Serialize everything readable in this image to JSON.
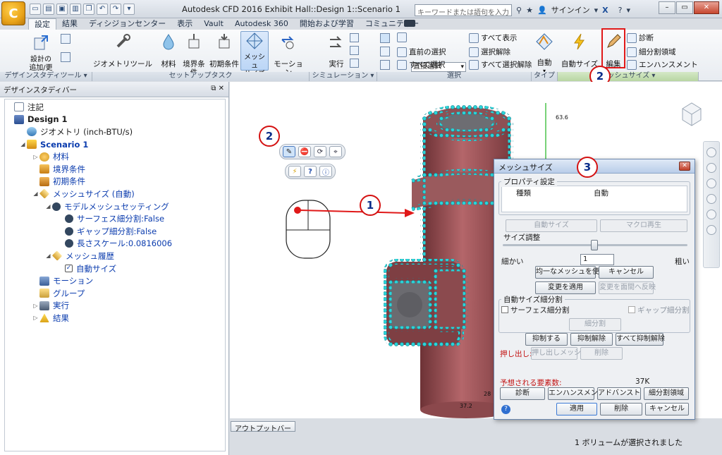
{
  "app": {
    "title": "Autodesk CFD 2016   Exhibit Hall::Design 1::Scenario 1",
    "search_placeholder": "キーワードまたは語句を入力",
    "signin": "サインイン"
  },
  "tabs": [
    "設定",
    "結果",
    "ディシジョンセンター",
    "表示",
    "Vault",
    "Autodesk 360",
    "開始および学習",
    "コミュニティー"
  ],
  "ribbon": {
    "design_study": {
      "add_update": "設計の\n追加/更新",
      "footer": "デザインスタディツール ▾"
    },
    "setup": {
      "geometry_tool": "ジオメトリツール",
      "materials": "材料",
      "boundary": "境界条件",
      "initial": "初期条件",
      "mesh_size": "メッシュ\nサイズ",
      "motion": "モーション",
      "footer": "セットアップタスク"
    },
    "simulation": {
      "run": "実行",
      "footer": "シミュレーション ▾"
    },
    "selection": {
      "combo": "直接選択",
      "prev": "直前の選択",
      "all": "すべて選択",
      "show_all": "すべて表示",
      "deselect": "選択解除",
      "deselect_all": "すべて選択解除",
      "footer": "選択"
    },
    "type": {
      "auto": "自動",
      "footer": "タイプ"
    },
    "mesh": {
      "auto_size": "自動サイズ",
      "edit": "編集",
      "diagnose": "診断",
      "refine": "細分割領域",
      "enhance": "エンハンスメント",
      "footer": "メッシュサイズ ▾"
    }
  },
  "browser": {
    "title": "デザインスタディバー",
    "nodes": [
      {
        "label": "注記",
        "icon": "note-icon"
      },
      {
        "label": "Design 1",
        "icon": "design-icon"
      },
      {
        "label": "ジオメトリ (inch-BTU/s)",
        "icon": "geometry-icon"
      },
      {
        "label": "Scenario 1",
        "icon": "scenario-icon"
      },
      {
        "label": "材料",
        "icon": "materials-icon"
      },
      {
        "label": "境界条件",
        "icon": "boundary-icon"
      },
      {
        "label": "初期条件",
        "icon": "initial-icon"
      },
      {
        "label": "メッシュサイズ (自動)",
        "icon": "mesh-icon"
      },
      {
        "label": "モデルメッシュセッティング",
        "icon": "info-icon"
      },
      {
        "label": "サーフェス細分割:False",
        "icon": "info-icon"
      },
      {
        "label": "ギャップ細分割:False",
        "icon": "info-icon"
      },
      {
        "label": "長さスケール:0.0816006",
        "icon": "info-icon"
      },
      {
        "label": "メッシュ履歴",
        "icon": "mesh-icon"
      },
      {
        "label": "自動サイズ",
        "icon": "checkbox-icon"
      },
      {
        "label": "モーション",
        "icon": "motion-icon"
      },
      {
        "label": "グループ",
        "icon": "group-icon"
      },
      {
        "label": "実行",
        "icon": "run-icon"
      },
      {
        "label": "結果",
        "icon": "results-icon"
      }
    ]
  },
  "viewport": {
    "dim_top": "63.6",
    "dim_bottom": "37.2",
    "dim_side": "28"
  },
  "dialog": {
    "title": "メッシュサイズ",
    "props_legend": "プロパティ設定",
    "col_type": "種類",
    "col_auto": "自動",
    "auto_size_btn": "自動サイズ",
    "macro_btn": "マクロ再生",
    "size_legend": "サイズ調整",
    "fine": "細かい",
    "coarse": "粗い",
    "size_value": "1",
    "uniform_btn": "均一なメッシュを使用",
    "cancel_btn": "キャンセル",
    "apply_change_btn": "変更を適用",
    "reflect_btn": "変更を面間へ反映",
    "auto_refine_legend": "自動サイズ細分割",
    "surface_refine": "サーフェス細分割",
    "gap_refine": "ギャップ細分割",
    "refine_btn": "細分割",
    "suppress_btn": "抑制する",
    "unsuppress_btn": "抑制解除",
    "unsuppress_all_btn": "すべて抑制解除",
    "extrude_label": "押し出し:",
    "extrude_mesh_btn": "押し出しメッシュ",
    "delete_btn": "削除",
    "est_label": "予想される要素数:",
    "est_value": "37K",
    "diag_btn": "診断",
    "enh_btn": "エンハンスメント",
    "adv_btn": "アドバンスト",
    "refine_region_btn": "細分割領域",
    "apply_btn": "適用",
    "remove_btn": "削除",
    "cancel2_btn": "キャンセル"
  },
  "output_bar": "アウトプットバー",
  "status": "1 ボリュームが選択されました",
  "callouts": [
    "1",
    "2",
    "2",
    "3"
  ],
  "colors": {
    "accent": "#3399ff",
    "body": "#9a5a5d",
    "mesh_dots": "#2ad4d8",
    "callout_border": "#d41111"
  }
}
